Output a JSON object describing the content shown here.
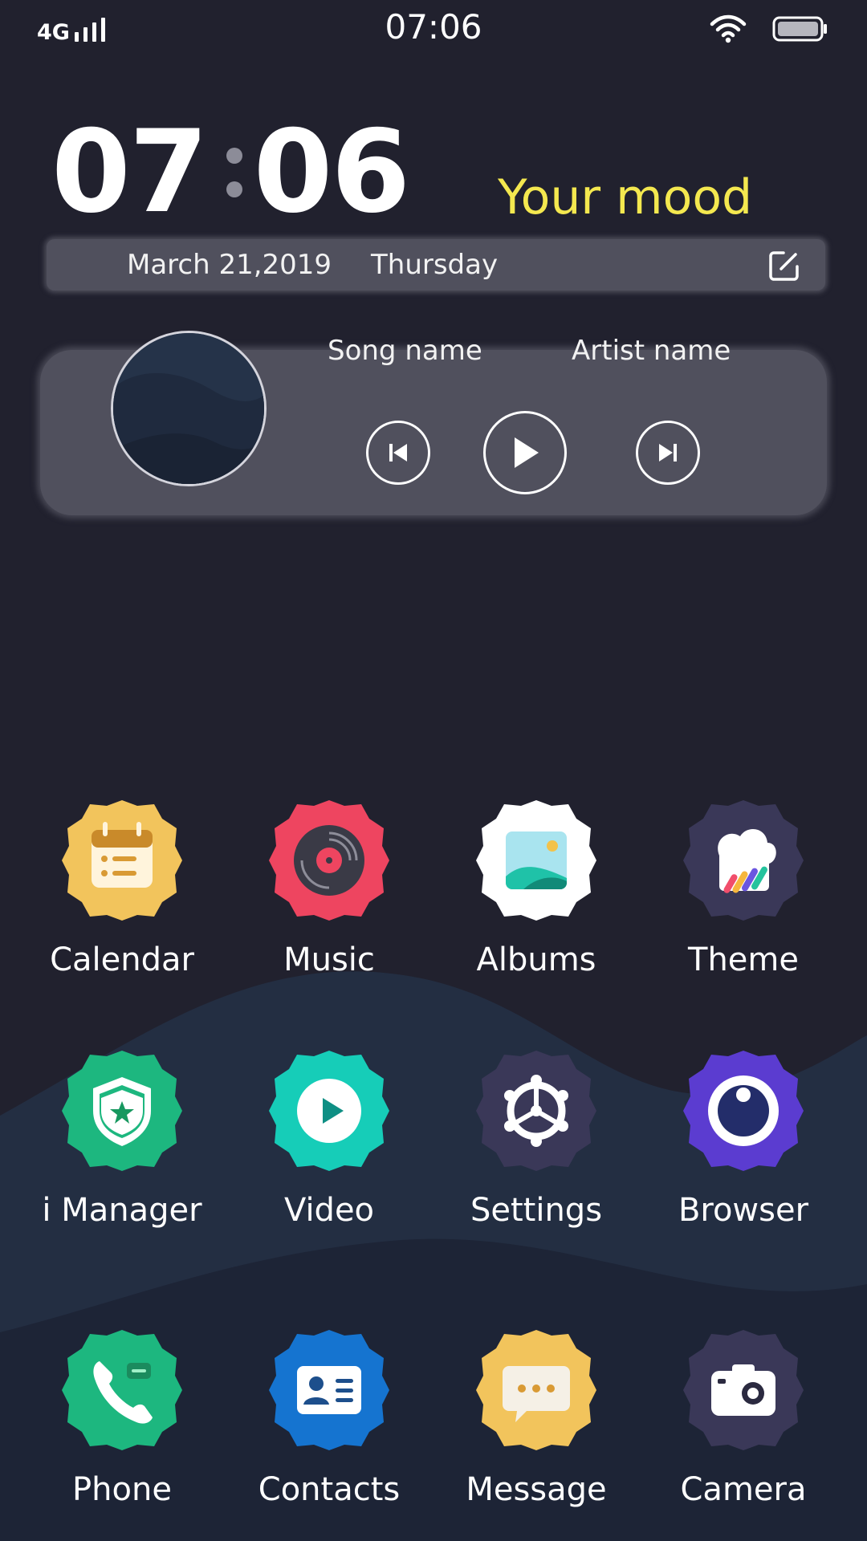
{
  "status_bar": {
    "network": "4G",
    "time": "07:06",
    "signal_icon": "signal-bars-icon",
    "wifi_icon": "wifi-icon",
    "battery_icon": "battery-icon"
  },
  "clock_widget": {
    "hours": "07",
    "minutes": "06",
    "mood": "Your mood",
    "mood_color": "#f4e84f",
    "date": "March 21,2019",
    "day": "Thursday",
    "edit_icon": "edit-icon"
  },
  "music_widget": {
    "song": "Song name",
    "artist": "Artist name",
    "controls": {
      "previous_icon": "skip-previous-icon",
      "play_icon": "play-icon",
      "next_icon": "skip-next-icon"
    }
  },
  "apps": [
    {
      "label": "Calendar",
      "icon": "calendar-icon",
      "color": "#f2c45c"
    },
    {
      "label": "Music",
      "icon": "vinyl-record-icon",
      "color": "#ee4560"
    },
    {
      "label": "Albums",
      "icon": "photo-icon",
      "color": "#ffffff"
    },
    {
      "label": "Theme",
      "icon": "theme-brush-icon",
      "color": "#3a3858"
    },
    {
      "label": "i Manager",
      "icon": "shield-star-icon",
      "color": "#1db77f"
    },
    {
      "label": "Video",
      "icon": "play-circle-icon",
      "color": "#16cdb8"
    },
    {
      "label": "Settings",
      "icon": "gear-icon",
      "color": "#3a3858"
    },
    {
      "label": "Browser",
      "icon": "browser-eye-icon",
      "color": "#5b3cd0"
    },
    {
      "label": "Phone",
      "icon": "phone-icon",
      "color": "#1db77f"
    },
    {
      "label": "Contacts",
      "icon": "contact-card-icon",
      "color": "#1574d0"
    },
    {
      "label": "Message",
      "icon": "chat-bubble-icon",
      "color": "#f2c45c"
    },
    {
      "label": "Camera",
      "icon": "camera-icon",
      "color": "#3a3858"
    }
  ]
}
